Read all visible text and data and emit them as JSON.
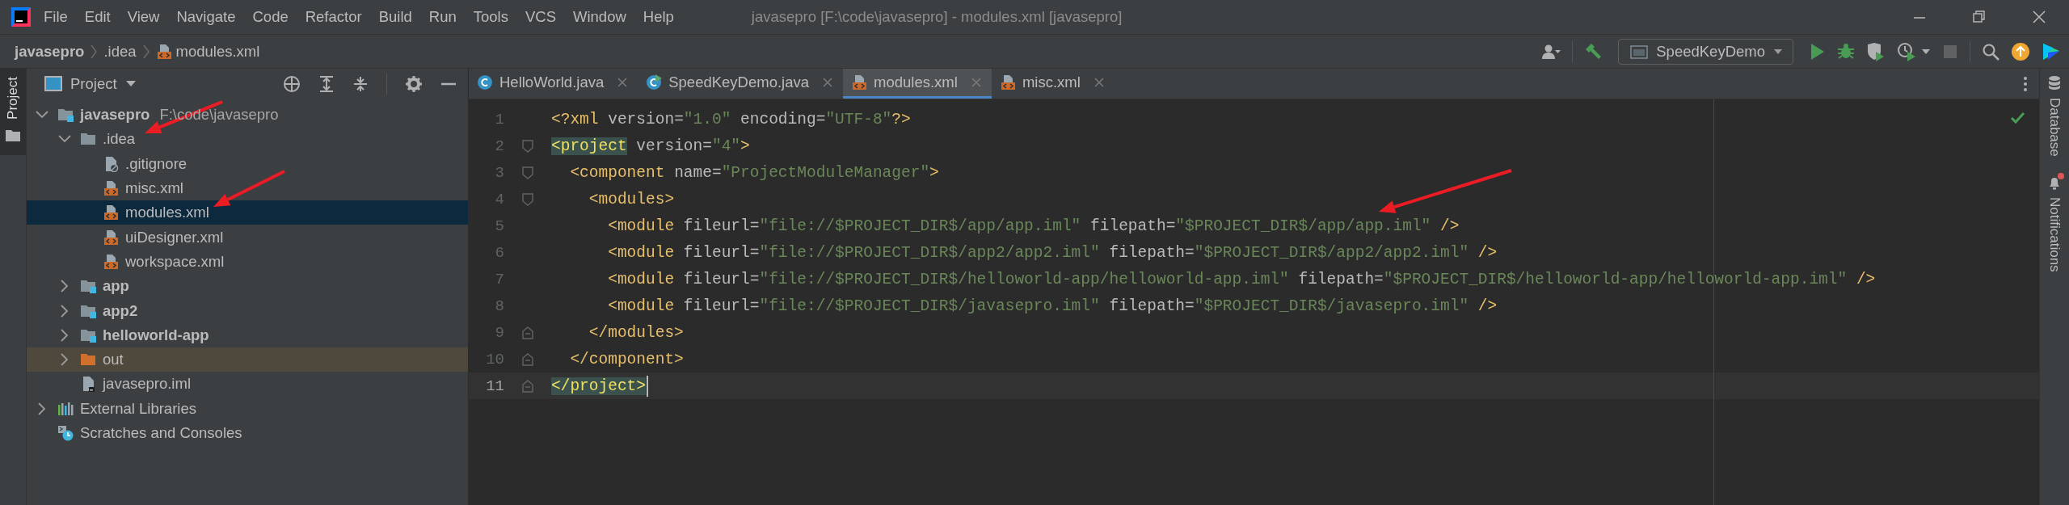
{
  "window": {
    "title": "javasepro [F:\\code\\javasepro] - modules.xml [javasepro]",
    "menu": [
      "File",
      "Edit",
      "View",
      "Navigate",
      "Code",
      "Refactor",
      "Build",
      "Run",
      "Tools",
      "VCS",
      "Window",
      "Help"
    ]
  },
  "breadcrumb": [
    {
      "label": "javasepro",
      "kind": "module"
    },
    {
      "label": ".idea",
      "kind": "folder"
    },
    {
      "label": "modules.xml",
      "kind": "xml"
    }
  ],
  "toolbar": {
    "run_configuration": "SpeedKeyDemo"
  },
  "left_stripe": [
    {
      "label": "Project",
      "selected": true
    }
  ],
  "project_panel": {
    "title": "Project",
    "tree": [
      {
        "label": "javasepro",
        "hint": "F:\\code\\javasepro",
        "kind": "module",
        "expanded": true,
        "selected": false,
        "children": [
          {
            "label": ".idea",
            "kind": "folder",
            "expanded": true,
            "selected": false,
            "children": [
              {
                "label": ".gitignore",
                "kind": "ignore-file",
                "selected": false
              },
              {
                "label": "misc.xml",
                "kind": "xml",
                "selected": false
              },
              {
                "label": "modules.xml",
                "kind": "xml",
                "selected": true
              },
              {
                "label": "uiDesigner.xml",
                "kind": "xml",
                "selected": false
              },
              {
                "label": "workspace.xml",
                "kind": "xml",
                "selected": false
              }
            ]
          },
          {
            "label": "app",
            "kind": "module",
            "expanded": false,
            "selected": false
          },
          {
            "label": "app2",
            "kind": "module",
            "expanded": false,
            "selected": false
          },
          {
            "label": "helloworld-app",
            "kind": "module",
            "expanded": false,
            "selected": false
          },
          {
            "label": "out",
            "kind": "excluded-folder",
            "expanded": false,
            "selected": false
          },
          {
            "label": "javasepro.iml",
            "kind": "iml",
            "selected": false
          }
        ]
      },
      {
        "label": "External Libraries",
        "kind": "libraries",
        "expanded": false,
        "selected": false
      },
      {
        "label": "Scratches and Consoles",
        "kind": "scratches",
        "selected": false
      }
    ]
  },
  "editor": {
    "tabs": [
      {
        "label": "HelloWorld.java",
        "kind": "class",
        "selected": false
      },
      {
        "label": "SpeedKeyDemo.java",
        "kind": "runnable-class",
        "selected": false
      },
      {
        "label": "modules.xml",
        "kind": "xml",
        "selected": true
      },
      {
        "label": "misc.xml",
        "kind": "xml",
        "selected": false
      }
    ],
    "lines": [
      {
        "number": "1",
        "kind": "plain",
        "current": false,
        "bracket_match": false,
        "tokens": [
          {
            "kind": "tag",
            "text": "<?xml"
          },
          {
            "kind": "attr",
            "text": " version="
          },
          {
            "kind": "value",
            "text": "\"1.0\""
          },
          {
            "kind": "attr",
            "text": " encoding="
          },
          {
            "kind": "value",
            "text": "\"UTF-8\""
          },
          {
            "kind": "tag",
            "text": "?>"
          }
        ]
      },
      {
        "number": "2",
        "current": false,
        "bracket_match": true,
        "kind": "fold-start",
        "tokens": [
          {
            "kind": "tag",
            "text": "<project"
          },
          {
            "kind": "attr",
            "text": " version="
          },
          {
            "kind": "value",
            "text": "\"4\""
          },
          {
            "kind": "tag",
            "text": ">"
          }
        ]
      },
      {
        "number": "3",
        "current": false,
        "bracket_match": false,
        "kind": "fold-start",
        "tokens": [
          {
            "kind": "tag",
            "text": "  <component"
          },
          {
            "kind": "attr",
            "text": " name="
          },
          {
            "kind": "value",
            "text": "\"ProjectModuleManager\""
          },
          {
            "kind": "tag",
            "text": ">"
          }
        ]
      },
      {
        "number": "4",
        "current": false,
        "bracket_match": false,
        "kind": "fold-start",
        "tokens": [
          {
            "kind": "tag",
            "text": "    <modules>"
          }
        ]
      },
      {
        "number": "5",
        "kind": "plain",
        "current": false,
        "bracket_match": false,
        "tokens": [
          {
            "kind": "tag",
            "text": "      <module"
          },
          {
            "kind": "attr",
            "text": " fileurl="
          },
          {
            "kind": "value",
            "text": "\"file://$PROJECT_DIR$/app/app.iml\""
          },
          {
            "kind": "attr",
            "text": " filepath="
          },
          {
            "kind": "value",
            "text": "\"$PROJECT_DIR$/app/app.iml\""
          },
          {
            "kind": "tag",
            "text": " />"
          }
        ]
      },
      {
        "number": "6",
        "kind": "plain",
        "current": false,
        "bracket_match": false,
        "tokens": [
          {
            "kind": "tag",
            "text": "      <module"
          },
          {
            "kind": "attr",
            "text": " fileurl="
          },
          {
            "kind": "value",
            "text": "\"file://$PROJECT_DIR$/app2/app2.iml\""
          },
          {
            "kind": "attr",
            "text": " filepath="
          },
          {
            "kind": "value",
            "text": "\"$PROJECT_DIR$/app2/app2.iml\""
          },
          {
            "kind": "tag",
            "text": " />"
          }
        ]
      },
      {
        "number": "7",
        "kind": "plain",
        "current": false,
        "bracket_match": false,
        "tokens": [
          {
            "kind": "tag",
            "text": "      <module"
          },
          {
            "kind": "attr",
            "text": " fileurl="
          },
          {
            "kind": "value",
            "text": "\"file://$PROJECT_DIR$/helloworld-app/helloworld-app.iml\""
          },
          {
            "kind": "attr",
            "text": " filepath="
          },
          {
            "kind": "value",
            "text": "\"$PROJECT_DIR$/helloworld-app/helloworld-app.iml\""
          },
          {
            "kind": "tag",
            "text": " />"
          }
        ]
      },
      {
        "number": "8",
        "kind": "plain",
        "current": false,
        "bracket_match": false,
        "tokens": [
          {
            "kind": "tag",
            "text": "      <module"
          },
          {
            "kind": "attr",
            "text": " fileurl="
          },
          {
            "kind": "value",
            "text": "\"file://$PROJECT_DIR$/javasepro.iml\""
          },
          {
            "kind": "attr",
            "text": " filepath="
          },
          {
            "kind": "value",
            "text": "\"$PROJECT_DIR$/javasepro.iml\""
          },
          {
            "kind": "tag",
            "text": " />"
          }
        ]
      },
      {
        "number": "9",
        "current": false,
        "bracket_match": false,
        "kind": "fold-end",
        "tokens": [
          {
            "kind": "tag",
            "text": "    </modules>"
          }
        ]
      },
      {
        "number": "10",
        "current": false,
        "bracket_match": false,
        "kind": "fold-end",
        "tokens": [
          {
            "kind": "tag",
            "text": "  </component>"
          }
        ]
      },
      {
        "number": "11",
        "current": true,
        "bracket_match": true,
        "kind": "fold-end",
        "tokens": [
          {
            "kind": "tag",
            "text": "</project>"
          }
        ]
      }
    ]
  },
  "right_stripe": [
    {
      "label": "Database",
      "kind": "database",
      "badge": false
    },
    {
      "label": "Notifications",
      "kind": "notifications",
      "badge": true
    }
  ]
}
